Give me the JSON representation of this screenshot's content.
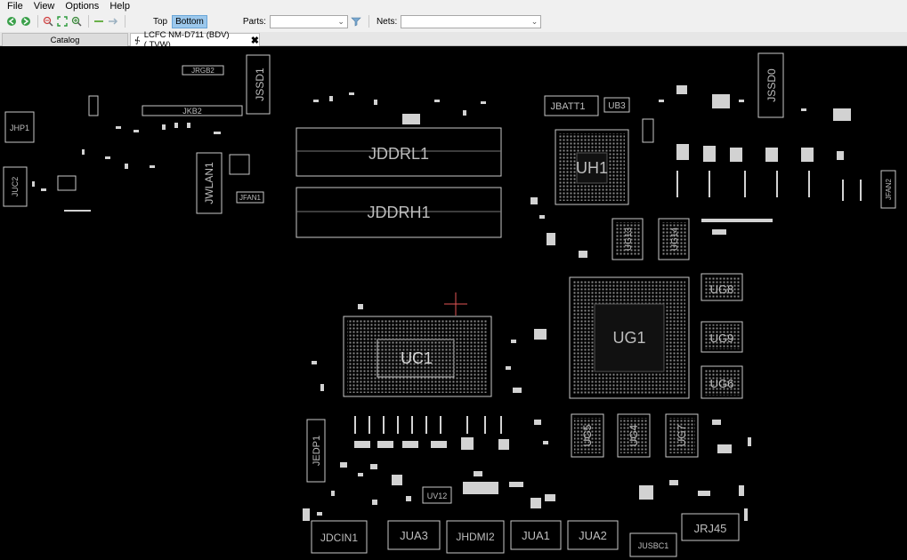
{
  "menu": [
    "File",
    "View",
    "Options",
    "Help"
  ],
  "toolbar": {
    "buttons": [
      "back-icon",
      "forward-icon",
      "zoom-out-icon",
      "fit-icon",
      "zoom-in-icon",
      "previous-icon",
      "next-icon"
    ],
    "side_top": "Top",
    "side_bottom": "Bottom",
    "parts_label": "Parts:",
    "parts_value": "",
    "nets_label": "Nets:",
    "nets_value": ""
  },
  "tabs": {
    "catalog": "Catalog",
    "board": "LCFC NM-D711 (BDV)(.TVW)"
  },
  "board": {
    "components": {
      "JHP1": "JHP1",
      "JUC2": "JUC2",
      "JRGB2": "JRGB2",
      "JKB2": "JKB2",
      "JSSD1": "JSSD1",
      "JWLAN1": "JWLAN1",
      "JFAN1": "JFAN1",
      "JDDRL1": "JDDRL1",
      "JDDRH1": "JDDRH1",
      "JBATT1": "JBATT1",
      "UB3": "UB3",
      "UH1": "UH1",
      "JSSD0": "JSSD0",
      "JFAN2": "JFAN2",
      "UG13": "UG13",
      "UG14": "UG14",
      "UG8": "UG8",
      "UG1": "UG1",
      "UG9": "UG9",
      "UG6": "UG6",
      "UC1": "UC1",
      "UG5": "UG5",
      "UG4": "UG4",
      "UG7": "UG7",
      "JEDP1": "JEDP1",
      "UV12": "UV12",
      "JDCIN1": "JDCIN1",
      "JUA3": "JUA3",
      "JHDMI2": "JHDMI2",
      "JUA1": "JUA1",
      "JUA2": "JUA2",
      "JUSBC1": "JUSBC1",
      "JRJ45": "JRJ45"
    }
  },
  "colors": {
    "board_bg": "#000000",
    "outline": "#c8c8c8",
    "pad": "#d2d2d2",
    "label": "#bdbdbd",
    "cursor": "#ff6666",
    "active_side": "#9cc8ec"
  }
}
